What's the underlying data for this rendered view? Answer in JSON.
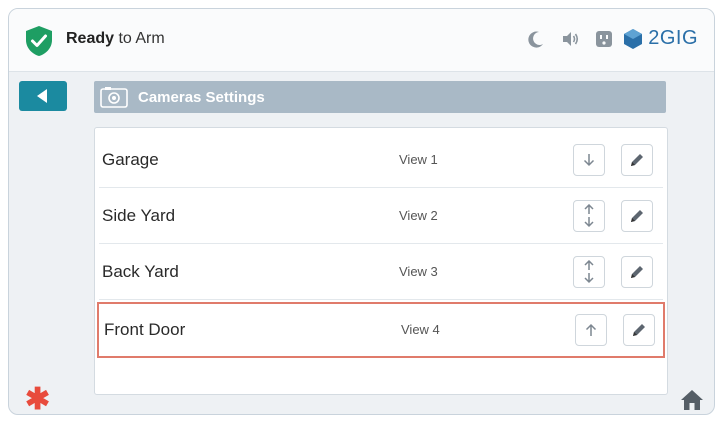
{
  "header": {
    "status_bold": "Ready",
    "status_rest": " to Arm",
    "brand": "2GIG",
    "icons": [
      "shield-check-icon",
      "moon-icon",
      "speaker-icon",
      "outlet-icon",
      "2gig-logo-icon"
    ]
  },
  "page": {
    "title": "Cameras Settings",
    "back_icon": "back-arrow-icon",
    "title_icon": "camera-icon"
  },
  "cameras": [
    {
      "name": "Garage",
      "view": "View 1",
      "move": "down"
    },
    {
      "name": "Side Yard",
      "view": "View 2",
      "move": "up-down"
    },
    {
      "name": "Back Yard",
      "view": "View 3",
      "move": "up-down"
    },
    {
      "name": "Front Door",
      "view": "View 4",
      "move": "up",
      "selected": true
    }
  ],
  "footer": {
    "left_icon": "asterisk-icon",
    "right_icon": "home-icon"
  },
  "colors": {
    "accent": "#1b8aa0",
    "title_bar": "#a9b9c6",
    "selection": "#e07b6b",
    "shield": "#1e9e63",
    "asterisk": "#e84b3c"
  }
}
